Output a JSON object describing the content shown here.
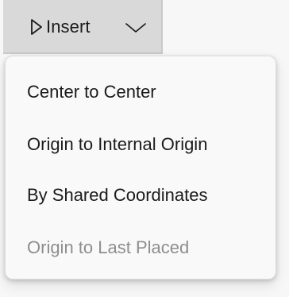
{
  "insert_button": {
    "label": "Insert",
    "leading_icon": "play-outline-icon",
    "trailing_icon": "chevron-down-icon"
  },
  "menu": {
    "items": [
      {
        "label": "Center to Center",
        "enabled": true
      },
      {
        "label": "Origin to Internal Origin",
        "enabled": true
      },
      {
        "label": "By Shared Coordinates",
        "enabled": true
      },
      {
        "label": "Origin to Last Placed",
        "enabled": false
      }
    ]
  },
  "colors": {
    "button_background": "#d9d9d9",
    "menu_background": "#f9f9f9",
    "text": "#1b1b1b",
    "disabled_text": "#8e8e8e"
  }
}
